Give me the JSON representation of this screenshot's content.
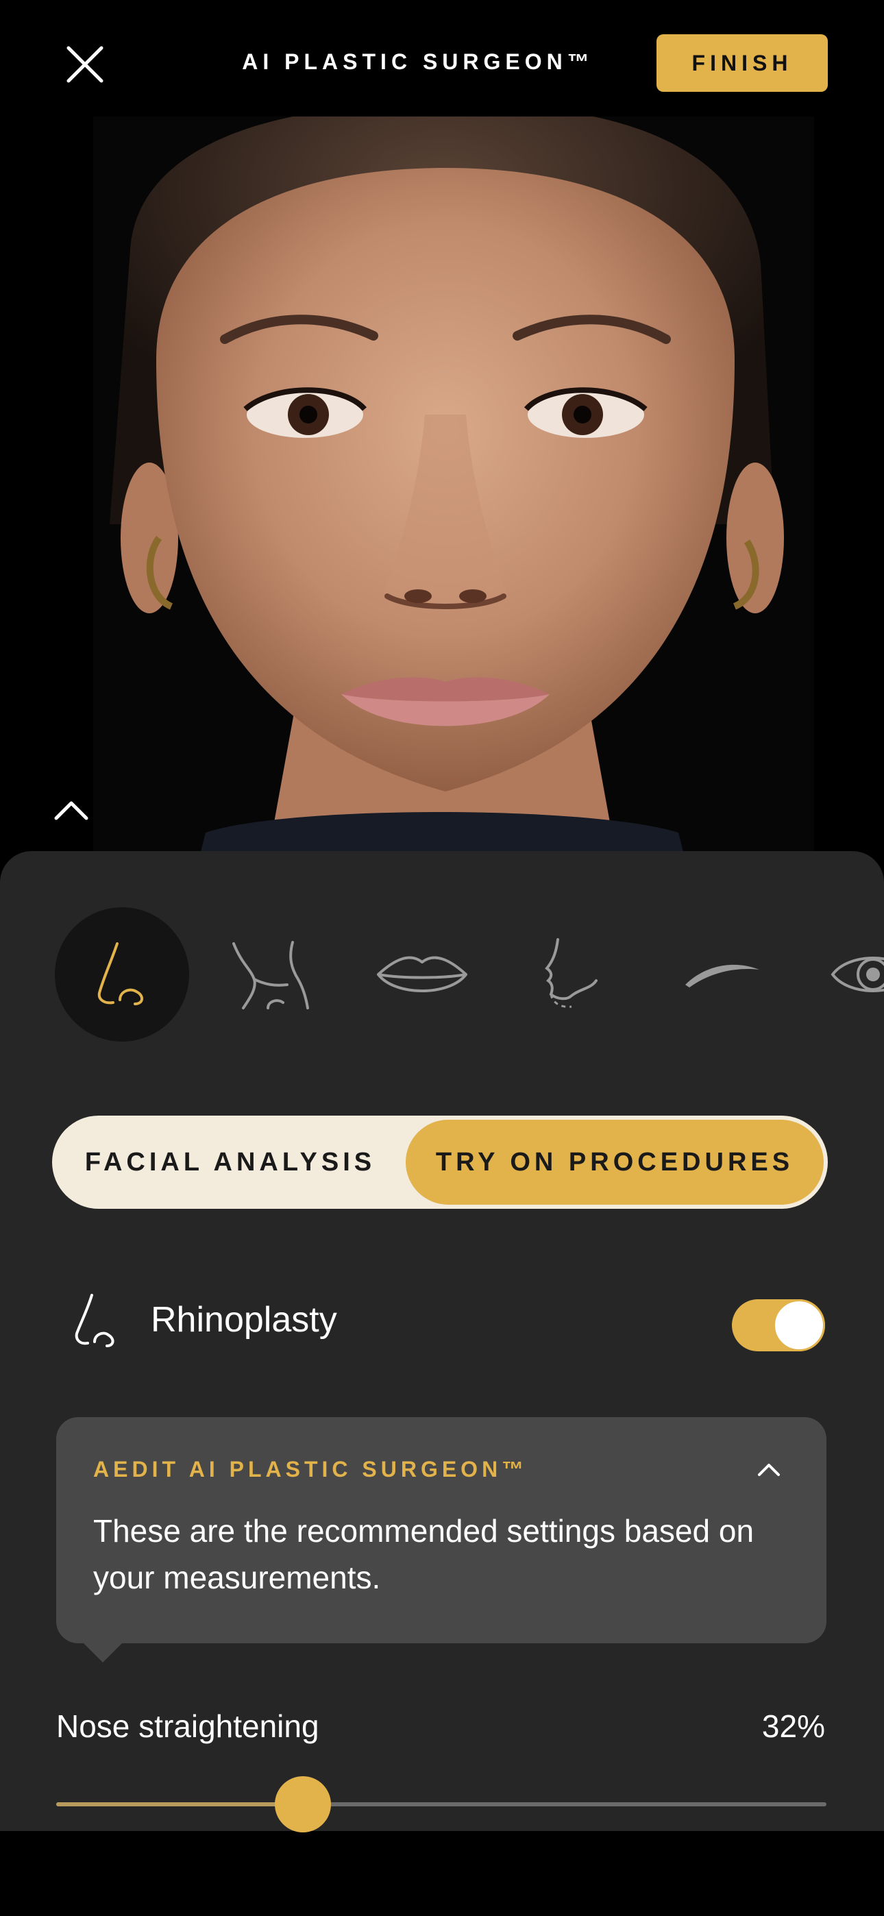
{
  "header": {
    "title": "AI PLASTIC SURGEON™",
    "finish_label": "FINISH"
  },
  "procedures": [
    {
      "name": "nose",
      "active": true
    },
    {
      "name": "neck",
      "active": false
    },
    {
      "name": "lips",
      "active": false
    },
    {
      "name": "chin",
      "active": false
    },
    {
      "name": "brow",
      "active": false
    },
    {
      "name": "eye",
      "active": false
    }
  ],
  "tabs": {
    "left": "FACIAL ANALYSIS",
    "right": "TRY ON PROCEDURES",
    "active": "right"
  },
  "procedure": {
    "label": "Rhinoplasty",
    "enabled": true
  },
  "tip": {
    "title": "AEDIT AI PLASTIC SURGEON™",
    "body": "These are the recommended settings based on your measurements."
  },
  "slider": {
    "label": "Nose straightening",
    "value_text": "32%",
    "value": 0.32
  },
  "colors": {
    "accent": "#E2B24B",
    "panel": "#262626",
    "tip_bg": "#484848",
    "segment_bg": "#F3ECDC"
  }
}
